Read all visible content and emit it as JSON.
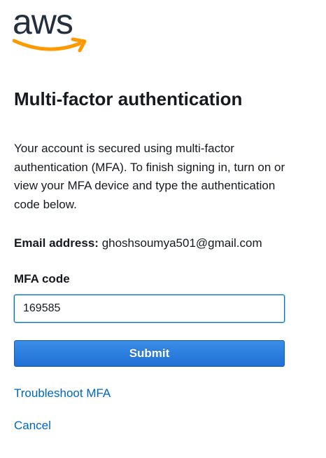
{
  "logo": {
    "text": "aws",
    "smile_color": "#ff9900"
  },
  "page": {
    "title": "Multi-factor authentication",
    "description": "Your account is secured using multi-factor authentication (MFA). To finish signing in, turn on or view your MFA device and type the authentication code below."
  },
  "email": {
    "label": "Email address:",
    "value": "ghoshsoumya501@gmail.com"
  },
  "mfa": {
    "label": "MFA code",
    "value": "169585"
  },
  "submit": {
    "label": "Submit"
  },
  "links": {
    "troubleshoot": "Troubleshoot MFA",
    "cancel": "Cancel"
  },
  "colors": {
    "button": "#1e70d6",
    "link": "#0066c0",
    "logo_text": "#232f3e"
  }
}
